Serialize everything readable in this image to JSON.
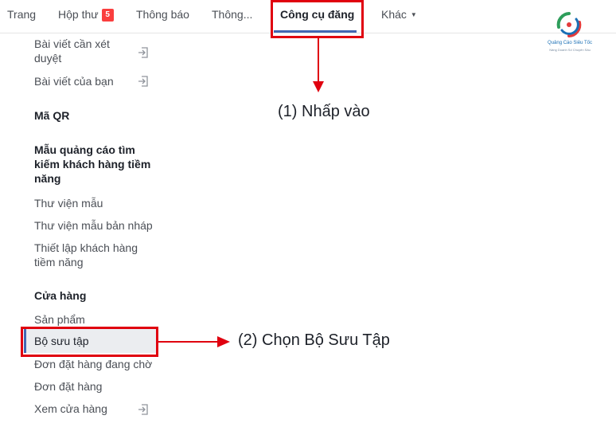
{
  "nav": {
    "home": "Trang",
    "inbox": "Hộp thư",
    "inbox_count": "5",
    "notifications": "Thông báo",
    "insights": "Thông...",
    "publishing_tools": "Công cụ đăng",
    "more": "Khác"
  },
  "logo": {
    "name": "Quảng Cáo Siêu Tốc",
    "tagline": "Nâng Doanh Số Chuyên Sâu"
  },
  "sidebar": {
    "pending_posts": "Bài viết cần xét duyệt",
    "your_posts": "Bài viết của bạn",
    "qr_heading": "Mã QR",
    "lead_ads_heading": "Mẫu quảng cáo tìm kiếm khách hàng tiềm năng",
    "form_library": "Thư viện mẫu",
    "draft_form_library": "Thư viện mẫu bản nháp",
    "lead_setup": "Thiết lập khách hàng tiềm năng",
    "shop_heading": "Cửa hàng",
    "products": "Sản phẩm",
    "collections": "Bộ sưu tập",
    "pending_orders": "Đơn đặt hàng đang chờ",
    "orders": "Đơn đặt hàng",
    "view_shop": "Xem cửa hàng"
  },
  "annotations": {
    "step1": "(1) Nhấp vào",
    "step2": "(2) Chọn Bộ Sưu Tập",
    "highlight_color": "#e0000f"
  },
  "icons": [
    "external-link-icon",
    "caret-down-icon",
    "logo-icon",
    "red-arrow-icon"
  ],
  "colors": {
    "accent": "#4267b2",
    "badge": "#fa3e3e",
    "annotation": "#e0000f"
  }
}
